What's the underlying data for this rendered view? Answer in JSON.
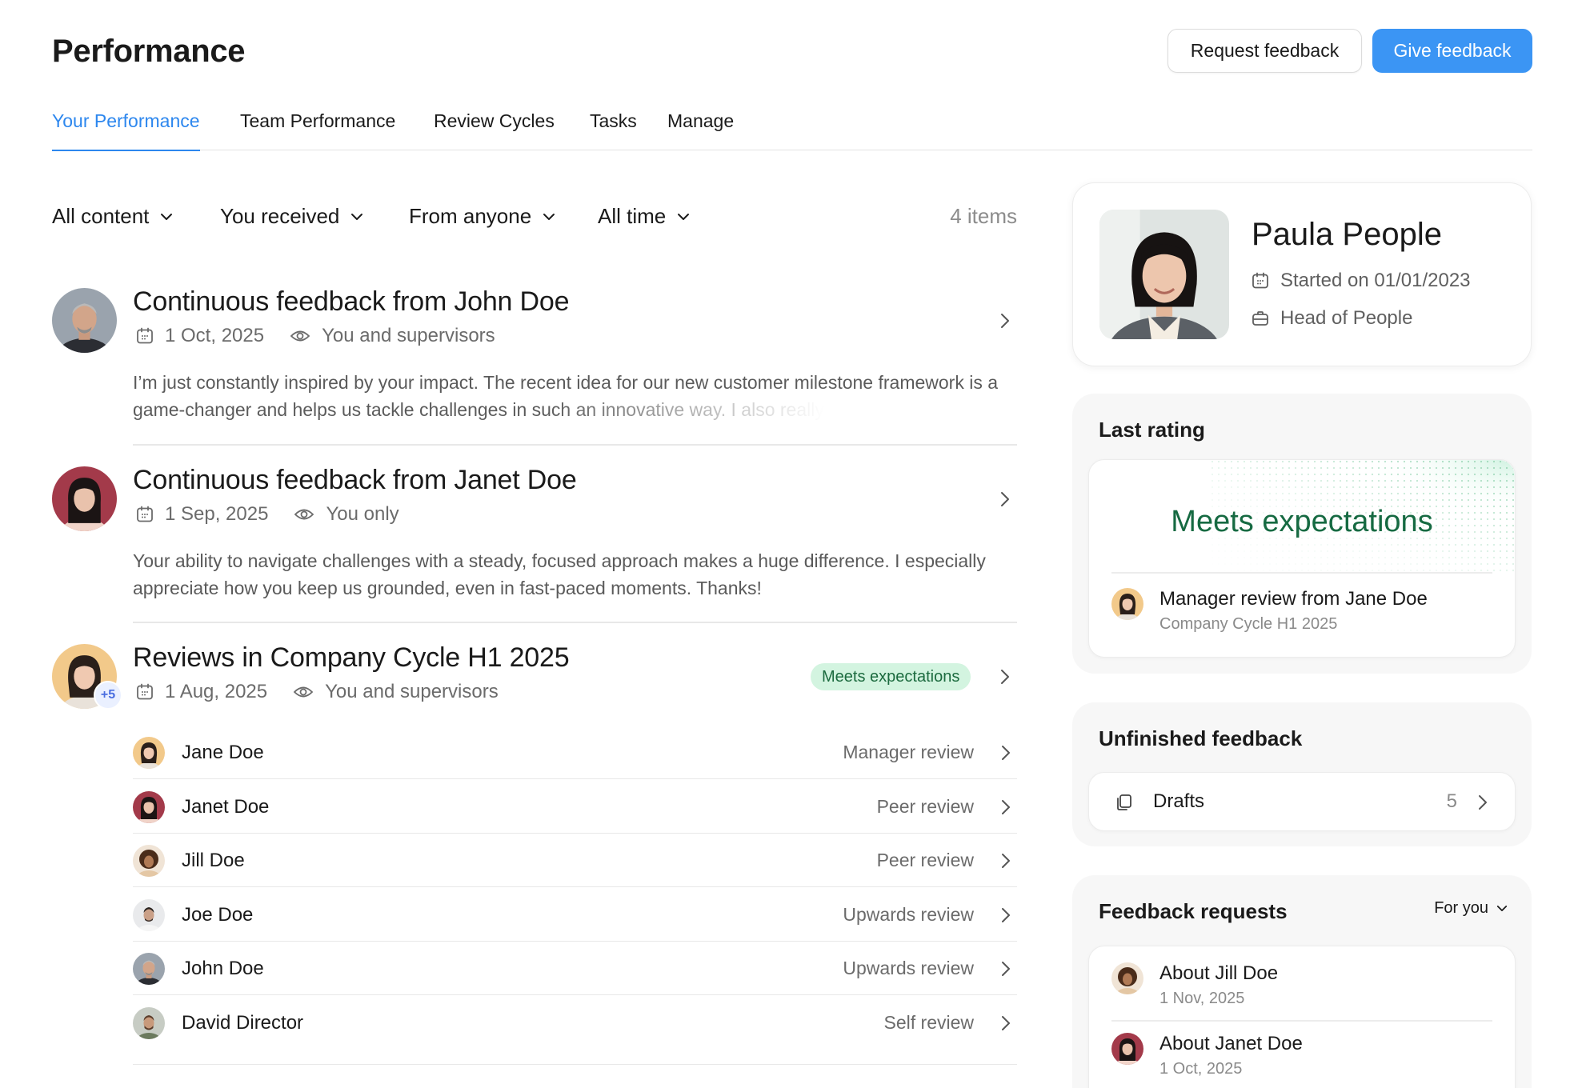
{
  "header": {
    "title": "Performance",
    "request_feedback": "Request feedback",
    "give_feedback": "Give feedback"
  },
  "tabs": [
    {
      "label": "Your Performance",
      "active": true
    },
    {
      "label": "Team Performance",
      "active": false
    },
    {
      "label": "Review Cycles",
      "active": false
    },
    {
      "label": "Tasks",
      "active": false
    },
    {
      "label": "Manage",
      "active": false
    }
  ],
  "filters": {
    "content": "All content",
    "direction": "You received",
    "source": "From anyone",
    "time": "All time",
    "count": "4 items"
  },
  "feedback": [
    {
      "title": "Continuous feedback from John Doe",
      "date": "1 Oct, 2025",
      "visibility": "You and supervisors",
      "body": "I’m just constantly inspired by your impact. The recent idea for our new customer milestone framework is a game-changer and helps us tackle challenges in such an innovative way. I also really"
    },
    {
      "title": "Continuous feedback from Janet Doe",
      "date": "1 Sep, 2025",
      "visibility": "You only",
      "body": "Your ability to navigate challenges with a steady, focused approach makes a huge difference. I especially appreciate how you keep us grounded, even in fast-paced moments. Thanks!"
    }
  ],
  "cycle": {
    "title": "Reviews in Company Cycle H1 2025",
    "date": "1 Aug, 2025",
    "visibility": "You and supervisors",
    "badge": "Meets expectations",
    "extra": "+5",
    "reviewers": [
      {
        "name": "Jane Doe",
        "type": "Manager review"
      },
      {
        "name": "Janet Doe",
        "type": "Peer review"
      },
      {
        "name": "Jill Doe",
        "type": "Peer review"
      },
      {
        "name": "Joe Doe",
        "type": "Upwards review"
      },
      {
        "name": "John Doe",
        "type": "Upwards review"
      },
      {
        "name": "David Director",
        "type": "Self review"
      }
    ]
  },
  "profile": {
    "name": "Paula People",
    "started": "Started on 01/01/2023",
    "role": "Head of People"
  },
  "last_rating": {
    "title": "Last rating",
    "value": "Meets expectations",
    "review_title": "Manager review from Jane Doe",
    "review_cycle": "Company Cycle H1 2025"
  },
  "unfinished": {
    "title": "Unfinished feedback",
    "drafts_label": "Drafts",
    "drafts_count": "5"
  },
  "requests": {
    "title": "Feedback requests",
    "filter": "For you",
    "items": [
      {
        "title": "About Jill Doe",
        "date": "1 Nov, 2025"
      },
      {
        "title": "About Janet Doe",
        "date": "1 Oct, 2025"
      }
    ]
  },
  "colors": {
    "accent": "#3b95f4",
    "tab_active": "#2d87ee",
    "rating": "#166a42",
    "badge_bg": "#d3f4e0"
  }
}
